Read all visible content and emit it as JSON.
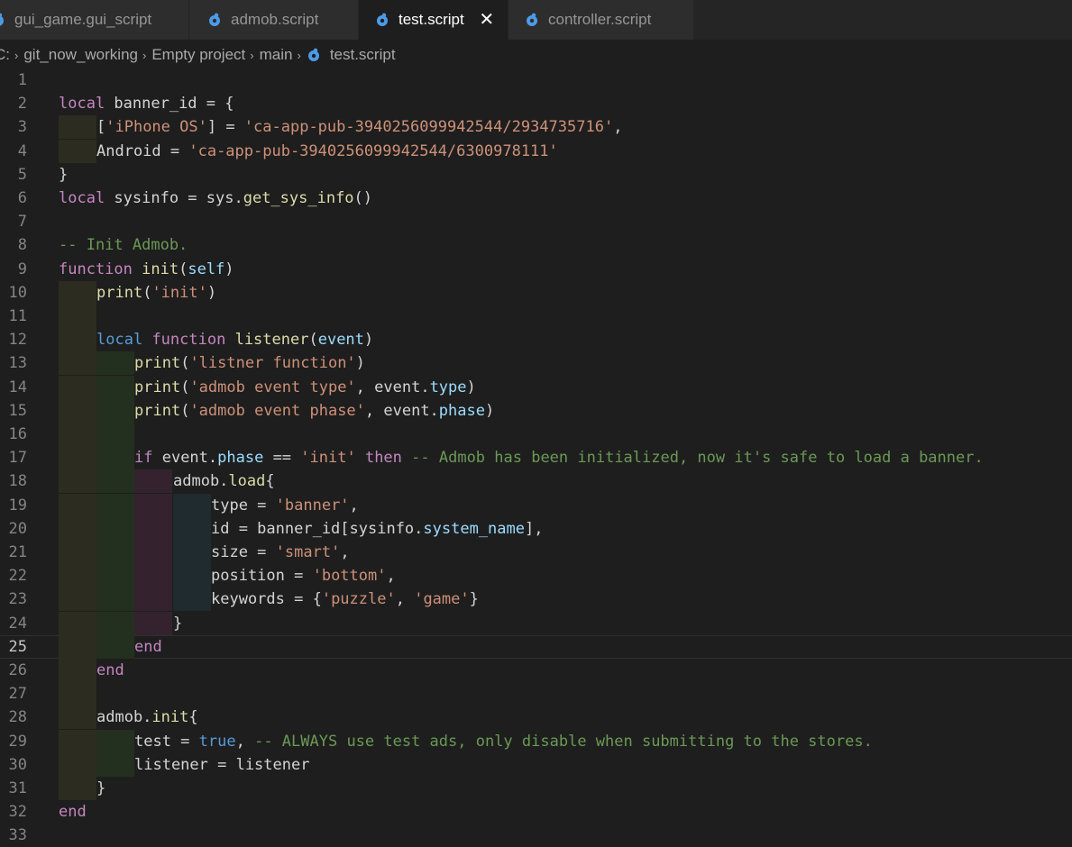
{
  "tabs": [
    {
      "label": "gui_game.gui_script",
      "active": false,
      "icon": "defold-script-icon"
    },
    {
      "label": "admob.script",
      "active": false,
      "icon": "defold-script-icon"
    },
    {
      "label": "test.script",
      "active": true,
      "icon": "defold-script-icon"
    },
    {
      "label": "controller.script",
      "active": false,
      "icon": "defold-script-icon"
    }
  ],
  "tab_close_glyph": "✕",
  "breadcrumb": {
    "drive": "C:",
    "segments": [
      "git_now_working",
      "Empty project",
      "main"
    ],
    "file": "test.script",
    "separator": "›"
  },
  "editor": {
    "language": "lua",
    "current_line": 25,
    "lines": [
      {
        "n": "1",
        "indent": 0,
        "tokens": []
      },
      {
        "n": "2",
        "indent": 0,
        "tokens": [
          [
            "kw",
            "local"
          ],
          [
            "id",
            " banner_id = {"
          ]
        ]
      },
      {
        "n": "3",
        "indent": 1,
        "tokens": [
          [
            "id",
            "["
          ],
          [
            "str",
            "'iPhone OS'"
          ],
          [
            "id",
            "] = "
          ],
          [
            "str",
            "'ca-app-pub-3940256099942544/2934735716'"
          ],
          [
            "id",
            ","
          ]
        ]
      },
      {
        "n": "4",
        "indent": 1,
        "tokens": [
          [
            "id",
            "Android = "
          ],
          [
            "str",
            "'ca-app-pub-3940256099942544/6300978111'"
          ]
        ]
      },
      {
        "n": "5",
        "indent": 0,
        "tokens": [
          [
            "id",
            "}"
          ]
        ]
      },
      {
        "n": "6",
        "indent": 0,
        "tokens": [
          [
            "kw",
            "local"
          ],
          [
            "id",
            " sysinfo = sys."
          ],
          [
            "fn",
            "get_sys_info"
          ],
          [
            "id",
            "()"
          ]
        ]
      },
      {
        "n": "7",
        "indent": 0,
        "tokens": []
      },
      {
        "n": "8",
        "indent": 0,
        "tokens": [
          [
            "cm",
            "-- Init Admob."
          ]
        ]
      },
      {
        "n": "9",
        "indent": 0,
        "tokens": [
          [
            "kw",
            "function"
          ],
          [
            "id",
            " "
          ],
          [
            "fn",
            "init"
          ],
          [
            "id",
            "("
          ],
          [
            "pr",
            "self"
          ],
          [
            "id",
            ")"
          ]
        ]
      },
      {
        "n": "10",
        "indent": 1,
        "tokens": [
          [
            "fn",
            "print"
          ],
          [
            "id",
            "("
          ],
          [
            "str",
            "'init'"
          ],
          [
            "id",
            ")"
          ]
        ]
      },
      {
        "n": "11",
        "indent": 1,
        "tokens": []
      },
      {
        "n": "12",
        "indent": 1,
        "tokens": [
          [
            "kw2",
            "local"
          ],
          [
            "id",
            " "
          ],
          [
            "kw",
            "function"
          ],
          [
            "id",
            " "
          ],
          [
            "fn",
            "listener"
          ],
          [
            "id",
            "("
          ],
          [
            "pr",
            "event"
          ],
          [
            "id",
            ")"
          ]
        ]
      },
      {
        "n": "13",
        "indent": 2,
        "tokens": [
          [
            "fn",
            "print"
          ],
          [
            "id",
            "("
          ],
          [
            "str",
            "'listner function'"
          ],
          [
            "id",
            ")"
          ]
        ]
      },
      {
        "n": "14",
        "indent": 2,
        "tokens": [
          [
            "fn",
            "print"
          ],
          [
            "id",
            "("
          ],
          [
            "str",
            "'admob event type'"
          ],
          [
            "id",
            ", event."
          ],
          [
            "pr",
            "type"
          ],
          [
            "id",
            ")"
          ]
        ]
      },
      {
        "n": "15",
        "indent": 2,
        "tokens": [
          [
            "fn",
            "print"
          ],
          [
            "id",
            "("
          ],
          [
            "str",
            "'admob event phase'"
          ],
          [
            "id",
            ", event."
          ],
          [
            "pr",
            "phase"
          ],
          [
            "id",
            ")"
          ]
        ]
      },
      {
        "n": "16",
        "indent": 2,
        "tokens": []
      },
      {
        "n": "17",
        "indent": 2,
        "tokens": [
          [
            "kw",
            "if"
          ],
          [
            "id",
            " event."
          ],
          [
            "pr",
            "phase"
          ],
          [
            "id",
            " == "
          ],
          [
            "str",
            "'init'"
          ],
          [
            "id",
            " "
          ],
          [
            "kw",
            "then"
          ],
          [
            "id",
            " "
          ],
          [
            "cm",
            "-- Admob has been initialized, now it's safe to load a banner."
          ]
        ]
      },
      {
        "n": "18",
        "indent": 3,
        "tokens": [
          [
            "id",
            "admob."
          ],
          [
            "fn",
            "load"
          ],
          [
            "id",
            "{"
          ]
        ]
      },
      {
        "n": "19",
        "indent": 4,
        "tokens": [
          [
            "id",
            "type = "
          ],
          [
            "str",
            "'banner'"
          ],
          [
            "id",
            ","
          ]
        ]
      },
      {
        "n": "20",
        "indent": 4,
        "tokens": [
          [
            "id",
            "id = banner_id[sysinfo."
          ],
          [
            "pr",
            "system_name"
          ],
          [
            "id",
            "],"
          ]
        ]
      },
      {
        "n": "21",
        "indent": 4,
        "tokens": [
          [
            "id",
            "size = "
          ],
          [
            "str",
            "'smart'"
          ],
          [
            "id",
            ","
          ]
        ]
      },
      {
        "n": "22",
        "indent": 4,
        "tokens": [
          [
            "id",
            "position = "
          ],
          [
            "str",
            "'bottom'"
          ],
          [
            "id",
            ","
          ]
        ]
      },
      {
        "n": "23",
        "indent": 4,
        "tokens": [
          [
            "id",
            "keywords = {"
          ],
          [
            "str",
            "'puzzle'"
          ],
          [
            "id",
            ", "
          ],
          [
            "str",
            "'game'"
          ],
          [
            "id",
            "}"
          ]
        ]
      },
      {
        "n": "24",
        "indent": 3,
        "tokens": [
          [
            "id",
            "}"
          ]
        ]
      },
      {
        "n": "25",
        "indent": 2,
        "tokens": [
          [
            "kw",
            "end"
          ]
        ]
      },
      {
        "n": "26",
        "indent": 1,
        "tokens": [
          [
            "kw",
            "end"
          ]
        ]
      },
      {
        "n": "27",
        "indent": 1,
        "tokens": []
      },
      {
        "n": "28",
        "indent": 1,
        "tokens": [
          [
            "id",
            "admob."
          ],
          [
            "fn",
            "init"
          ],
          [
            "id",
            "{"
          ]
        ]
      },
      {
        "n": "29",
        "indent": 2,
        "tokens": [
          [
            "id",
            "test = "
          ],
          [
            "kw2",
            "true"
          ],
          [
            "id",
            ", "
          ],
          [
            "cm",
            "-- ALWAYS use test ads, only disable when submitting to the stores."
          ]
        ]
      },
      {
        "n": "30",
        "indent": 2,
        "tokens": [
          [
            "id",
            "listener = listener"
          ]
        ]
      },
      {
        "n": "31",
        "indent": 1,
        "tokens": [
          [
            "id",
            "}"
          ]
        ]
      },
      {
        "n": "32",
        "indent": 0,
        "tokens": [
          [
            "kw",
            "end"
          ]
        ]
      },
      {
        "n": "33",
        "indent": 0,
        "tokens": []
      }
    ]
  }
}
